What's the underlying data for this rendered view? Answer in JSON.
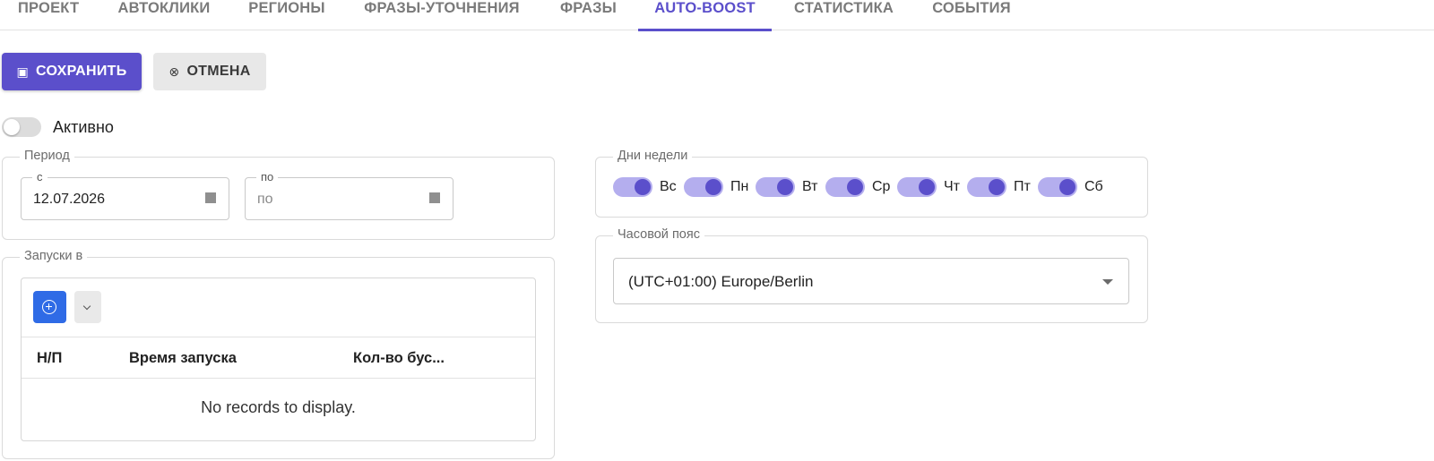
{
  "tabs": [
    {
      "label": "ПРОЕКТ",
      "active": false
    },
    {
      "label": "АВТОКЛИКИ",
      "active": false
    },
    {
      "label": "РЕГИОНЫ",
      "active": false
    },
    {
      "label": "ФРАЗЫ-УТОЧНЕНИЯ",
      "active": false
    },
    {
      "label": "ФРАЗЫ",
      "active": false
    },
    {
      "label": "AUTO-BOOST",
      "active": true
    },
    {
      "label": "СТАТИСТИКА",
      "active": false
    },
    {
      "label": "СОБЫТИЯ",
      "active": false
    }
  ],
  "toolbar": {
    "save_label": "СОХРАНИТЬ",
    "save_icon": "▣",
    "cancel_label": "ОТМЕНА",
    "cancel_icon": "⊗"
  },
  "active_toggle": {
    "label": "Активно",
    "on": false
  },
  "period": {
    "legend": "Период",
    "from_label": "с",
    "from_value": "12.07.2026",
    "to_label": "по",
    "to_placeholder": "по"
  },
  "launches": {
    "legend": "Запуски в",
    "columns": [
      "Н/П",
      "Время запуска",
      "Кол-во бус..."
    ],
    "empty_text": "No records to display."
  },
  "weekdays": {
    "legend": "Дни недели",
    "days": [
      {
        "label": "Вс",
        "on": true
      },
      {
        "label": "Пн",
        "on": true
      },
      {
        "label": "Вт",
        "on": true
      },
      {
        "label": "Ср",
        "on": true
      },
      {
        "label": "Чт",
        "on": true
      },
      {
        "label": "Пт",
        "on": true
      },
      {
        "label": "Сб",
        "on": true
      }
    ]
  },
  "timezone": {
    "legend": "Часовой пояс",
    "value": "(UTC+01:00) Europe/Berlin"
  },
  "colors": {
    "accent": "#5b4fcb",
    "accent_light": "#b4aeee",
    "add_button": "#2f6be6"
  }
}
